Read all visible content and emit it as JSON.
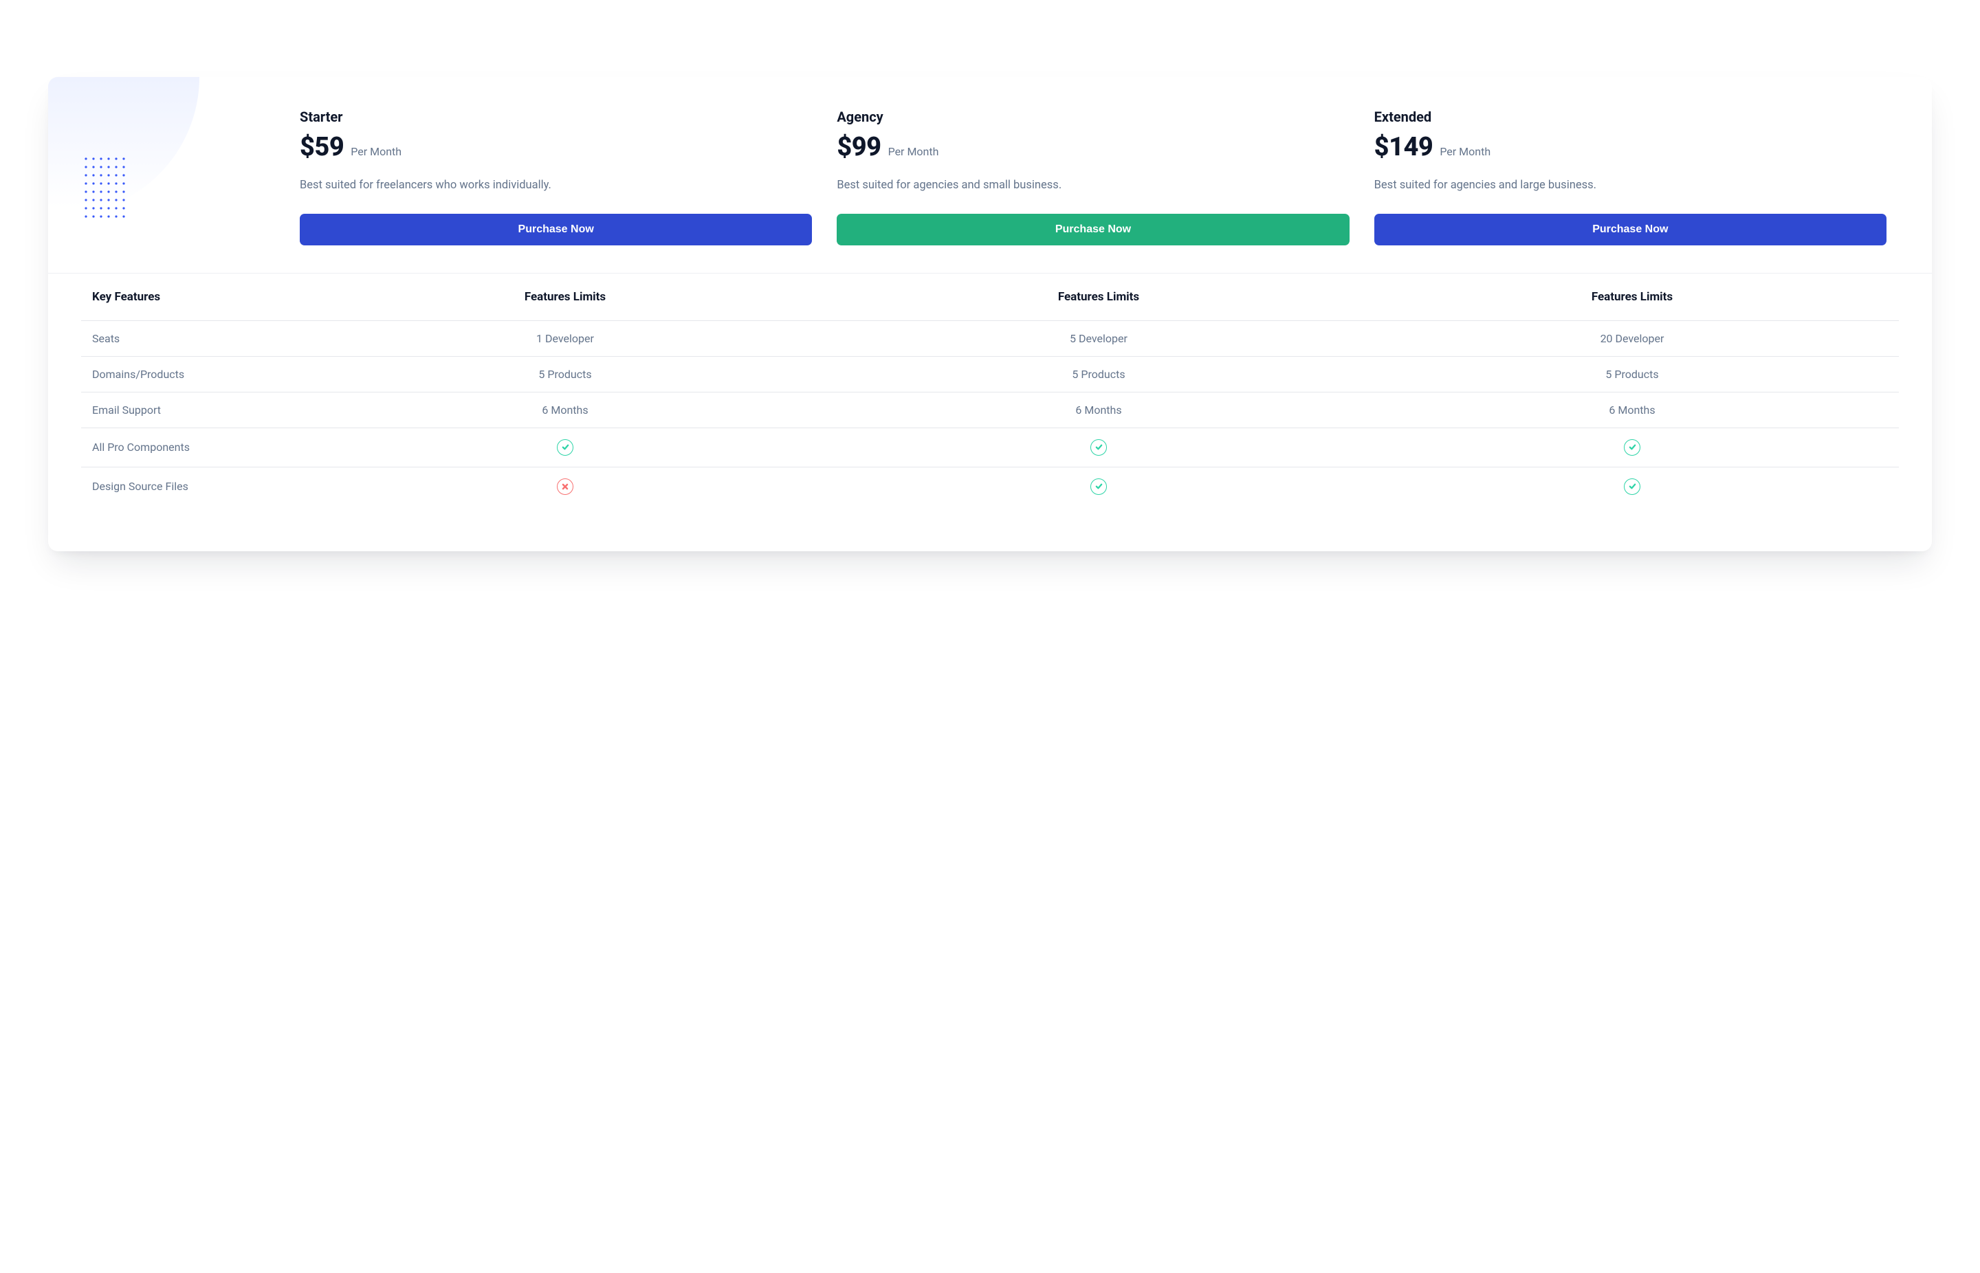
{
  "plans": [
    {
      "name": "Starter",
      "price": "$59",
      "period": "Per Month",
      "desc": "Best suited for freelancers who works individually.",
      "cta": "Purchase Now",
      "accent": "blue"
    },
    {
      "name": "Agency",
      "price": "$99",
      "period": "Per Month",
      "desc": "Best suited for agencies and small business.",
      "cta": "Purchase Now",
      "accent": "green"
    },
    {
      "name": "Extended",
      "price": "$149",
      "period": "Per Month",
      "desc": "Best suited for agencies and large business.",
      "cta": "Purchase Now",
      "accent": "blue"
    }
  ],
  "table": {
    "headers": [
      "Key Features",
      "Features Limits",
      "Features Limits",
      "Features Limits"
    ],
    "rows": [
      {
        "label": "Seats",
        "cells": [
          "1 Developer",
          "5 Developer",
          "20 Developer"
        ]
      },
      {
        "label": "Domains/Products",
        "cells": [
          "5 Products",
          "5 Products",
          "5 Products"
        ]
      },
      {
        "label": "Email Support",
        "cells": [
          "6 Months",
          "6 Months",
          "6 Months"
        ]
      },
      {
        "label": "All Pro Components",
        "cells": [
          "check",
          "check",
          "check"
        ]
      },
      {
        "label": "Design Source Files",
        "cells": [
          "cross",
          "check",
          "check"
        ]
      }
    ]
  }
}
